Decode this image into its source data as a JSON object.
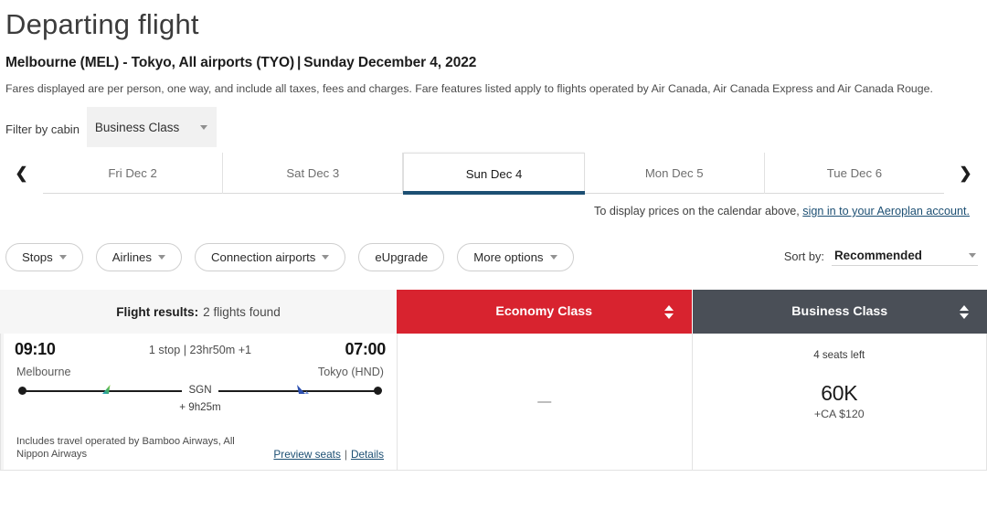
{
  "header": {
    "title": "Departing flight",
    "route_origin": "Melbourne (MEL) - Tokyo, All airports (TYO)",
    "route_separator": "|",
    "route_date": "Sunday December 4, 2022",
    "fares_note": "Fares displayed are per person, one way, and include all taxes, fees and charges. Fare features listed apply to flights operated by Air Canada, Air Canada Express and Air Canada Rouge."
  },
  "cabin_filter": {
    "label": "Filter by cabin",
    "selected": "Business Class",
    "caret_icon": "chevron-down-icon"
  },
  "date_bar": {
    "prev_icon": "chevron-left-icon",
    "next_icon": "chevron-right-icon",
    "tabs": [
      {
        "label": "Fri Dec 2",
        "active": false
      },
      {
        "label": "Sat Dec 3",
        "active": false
      },
      {
        "label": "Sun Dec 4",
        "active": true
      },
      {
        "label": "Mon Dec 5",
        "active": false
      },
      {
        "label": "Tue Dec 6",
        "active": false
      }
    ],
    "notice_text": "To display prices on the calendar above,",
    "notice_link": "sign in to your Aeroplan account."
  },
  "filters": {
    "pills": [
      {
        "label": "Stops",
        "has_caret": true
      },
      {
        "label": "Airlines",
        "has_caret": true
      },
      {
        "label": "Connection airports",
        "has_caret": true
      },
      {
        "label": "eUpgrade",
        "has_caret": false
      },
      {
        "label": "More options",
        "has_caret": true
      }
    ],
    "sort_label": "Sort by:",
    "sort_value": "Recommended"
  },
  "results_header": {
    "results_label": "Flight results:",
    "results_count": "2 flights found",
    "economy_label": "Economy Class",
    "business_label": "Business Class",
    "economy_color": "#d8232f",
    "business_color": "#4a4f57"
  },
  "flights": [
    {
      "depart_time": "09:10",
      "summary": "1 stop | 23hr50m +1",
      "arrive_time": "07:00",
      "origin_city": "Melbourne",
      "destination_city": "Tokyo (HND)",
      "stop_code": "SGN",
      "layover_duration": "+ 9h25m",
      "operated_by": "Includes travel operated by Bamboo Airways, All Nippon Airways",
      "preview_seats_link": "Preview seats",
      "link_separator": "|",
      "details_link": "Details",
      "economy": {
        "value": "—",
        "available": false
      },
      "business": {
        "seats_left": "4 seats left",
        "points": "60K",
        "taxes": "+CA $120",
        "available": true
      }
    }
  ]
}
